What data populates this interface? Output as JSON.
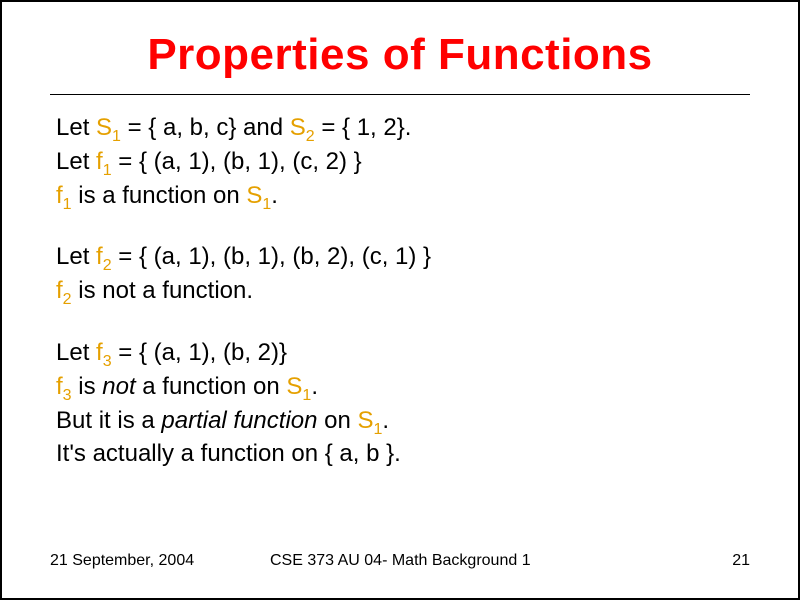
{
  "title": "Properties of Functions",
  "footer": {
    "date": "21 September, 2004",
    "course": "CSE 373 AU 04- Math Background 1",
    "page": "21"
  },
  "block1": {
    "line1_a": "Let ",
    "line1_s1": "S",
    "line1_sub1": "1",
    "line1_b": " = { a, b, c} and ",
    "line1_s2": "S",
    "line1_sub2": "2",
    "line1_c": " = { 1, 2}.",
    "line2_a": "Let ",
    "line2_f1": "f",
    "line2_sub1": "1",
    "line2_b": " = { (a, 1), (b, 1), (c, 2) }",
    "line3_f1": "f",
    "line3_sub1": "1",
    "line3_a": " is a function on ",
    "line3_s1": "S",
    "line3_sub2": "1",
    "line3_b": "."
  },
  "block2": {
    "line1_a": "Let ",
    "line1_f2": "f",
    "line1_sub1": "2",
    "line1_b": " = { (a, 1), (b, 1), (b, 2), (c, 1) }",
    "line2_f2": "f",
    "line2_sub1": "2",
    "line2_a": " is not a function."
  },
  "block3": {
    "line1_a": "Let ",
    "line1_f3": "f",
    "line1_sub1": "3",
    "line1_b": " = { (a, 1), (b, 2)}",
    "line2_f3": "f",
    "line2_sub1": "3",
    "line2_a": " is ",
    "line2_not": "not",
    "line2_b": " a function on ",
    "line2_s1": "S",
    "line2_sub2": "1",
    "line2_c": ".",
    "line3_a": "But it is a ",
    "line3_pf": "partial function",
    "line3_b": " on ",
    "line3_s1": "S",
    "line3_sub1": "1",
    "line3_c": ".",
    "line4": "It's actually a function on { a, b }."
  }
}
